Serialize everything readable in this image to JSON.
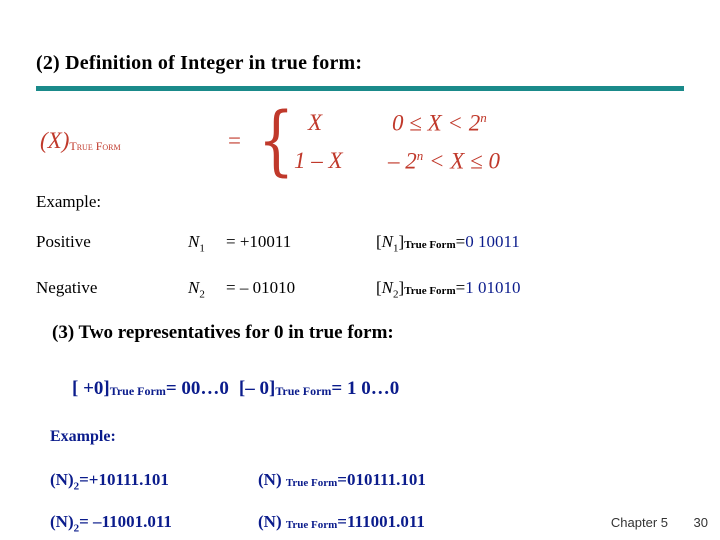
{
  "slide": {
    "title": "(2) Definition of Integer in true form:",
    "rule_color": "#1a8a8a",
    "formula": {
      "lhs": "(X)",
      "lhs_sub": "True Form",
      "equals": "=",
      "brace": "{",
      "case1_left": "X",
      "case1_right": "0 ≤ X < 2",
      "case1_exp": "n",
      "case2_left": "1 – X",
      "case2_right": "– 2",
      "case2_exp": "n",
      "case2_tail": "< X ≤ 0",
      "color": "#c0392b"
    },
    "example_label_1": "Example:",
    "rows": [
      {
        "label": "Positive",
        "name": "N",
        "name_sub": "1",
        "value": "= +10011",
        "result_prefix": "[",
        "result_name": "N",
        "result_sub": "1",
        "result_bracket": "]",
        "result_tf": "True Form",
        "result_eq": "=",
        "result_bits": "0 10011"
      },
      {
        "label": "Negative",
        "name": "N",
        "name_sub": "2",
        "value": "= – 01010",
        "result_prefix": "[",
        "result_name": "N",
        "result_sub": "2",
        "result_bracket": "]",
        "result_tf": "True Form",
        "result_eq": "=",
        "result_bits": "1 01010"
      }
    ],
    "heading_3": "(3) Two representatives for 0 in true form:",
    "zeros": {
      "first_open": "[ +0]",
      "first_tf": "True Form",
      "first_eq": "= 00…0",
      "second_open": "[– 0]",
      "second_tf": "True Form",
      "second_eq": "= 1 0…0"
    },
    "example_label_2": "Example:",
    "examples": [
      {
        "left_name": "(N)",
        "left_sub": "2",
        "left_value": "=+10111.101",
        "right_name": "(N) ",
        "right_tf": "True Form",
        "right_value": "=010111.101"
      },
      {
        "left_name": "(N)",
        "left_sub": "2",
        "left_value": "= –11001.011",
        "right_name": "(N) ",
        "right_tf": "True Form",
        "right_value": "=111001.011"
      }
    ],
    "footer": {
      "chapter": "Chapter 5",
      "page": "30"
    }
  }
}
